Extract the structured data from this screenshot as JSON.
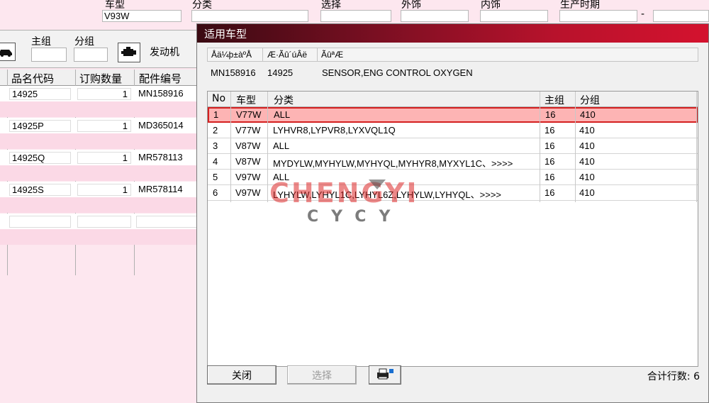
{
  "top_filters": {
    "model_label": "车型",
    "model_value": "V93W",
    "category_label": "分类",
    "select_label": "选择",
    "exterior_label": "外饰",
    "interior_label": "内饰",
    "production_label": "生产时期",
    "date_separator": "-"
  },
  "left_panel": {
    "main_group_label": "主组",
    "sub_group_label": "分组",
    "engine_label": "发动机",
    "columns": [
      "品名代码",
      "订购数量",
      "配件编号"
    ],
    "rows": [
      {
        "code": "14925",
        "qty": "1",
        "part": "MN158916"
      },
      {
        "code": "14925P",
        "qty": "1",
        "part": "MD365014"
      },
      {
        "code": "14925Q",
        "qty": "1",
        "part": "MR578113"
      },
      {
        "code": "14925S",
        "qty": "1",
        "part": "MR578114"
      },
      {
        "code": "",
        "qty": "",
        "part": ""
      }
    ]
  },
  "dialog": {
    "title": "适用车型",
    "info_headers": [
      "Åä¼þ±àºÅ",
      "Æ·Ãû´úÂë",
      "ÃûªÆ"
    ],
    "info_values": [
      "MN158916",
      "14925",
      "SENSOR,ENG CONTROL OXYGEN"
    ],
    "grid_headers": [
      "No",
      "车型",
      "分类",
      "主组",
      "分组"
    ],
    "grid_rows": [
      {
        "no": "1",
        "model": "V77W",
        "category": "ALL",
        "main": "16",
        "sub": "410"
      },
      {
        "no": "2",
        "model": "V77W",
        "category": "LYHVR8,LYPVR8,LYXVQL1Q",
        "main": "16",
        "sub": "410"
      },
      {
        "no": "3",
        "model": "V87W",
        "category": "ALL",
        "main": "16",
        "sub": "410"
      },
      {
        "no": "4",
        "model": "V87W",
        "category": "MYDYLW,MYHYLW,MYHYQL,MYHYR8,MYXYL1C、>>>>",
        "main": "16",
        "sub": "410"
      },
      {
        "no": "5",
        "model": "V97W",
        "category": "ALL",
        "main": "16",
        "sub": "410"
      },
      {
        "no": "6",
        "model": "V97W",
        "category": "LYHYLW,LYHYL1C,LYHYL6Z,LYHYLW,LYHYQL、>>>>",
        "main": "16",
        "sub": "410"
      }
    ],
    "selected_row": 1,
    "close_label": "关闭",
    "select_label": "选择",
    "total_label": "合计行数: 6"
  },
  "watermark": {
    "line1": "CHENGYI",
    "line2": "CYCY"
  },
  "colors": {
    "title_gradient_end": "#d4122e",
    "selected_row_bg": "#fdb4b4",
    "selected_row_border": "#d42020",
    "panel_bg": "#fde7ef"
  }
}
